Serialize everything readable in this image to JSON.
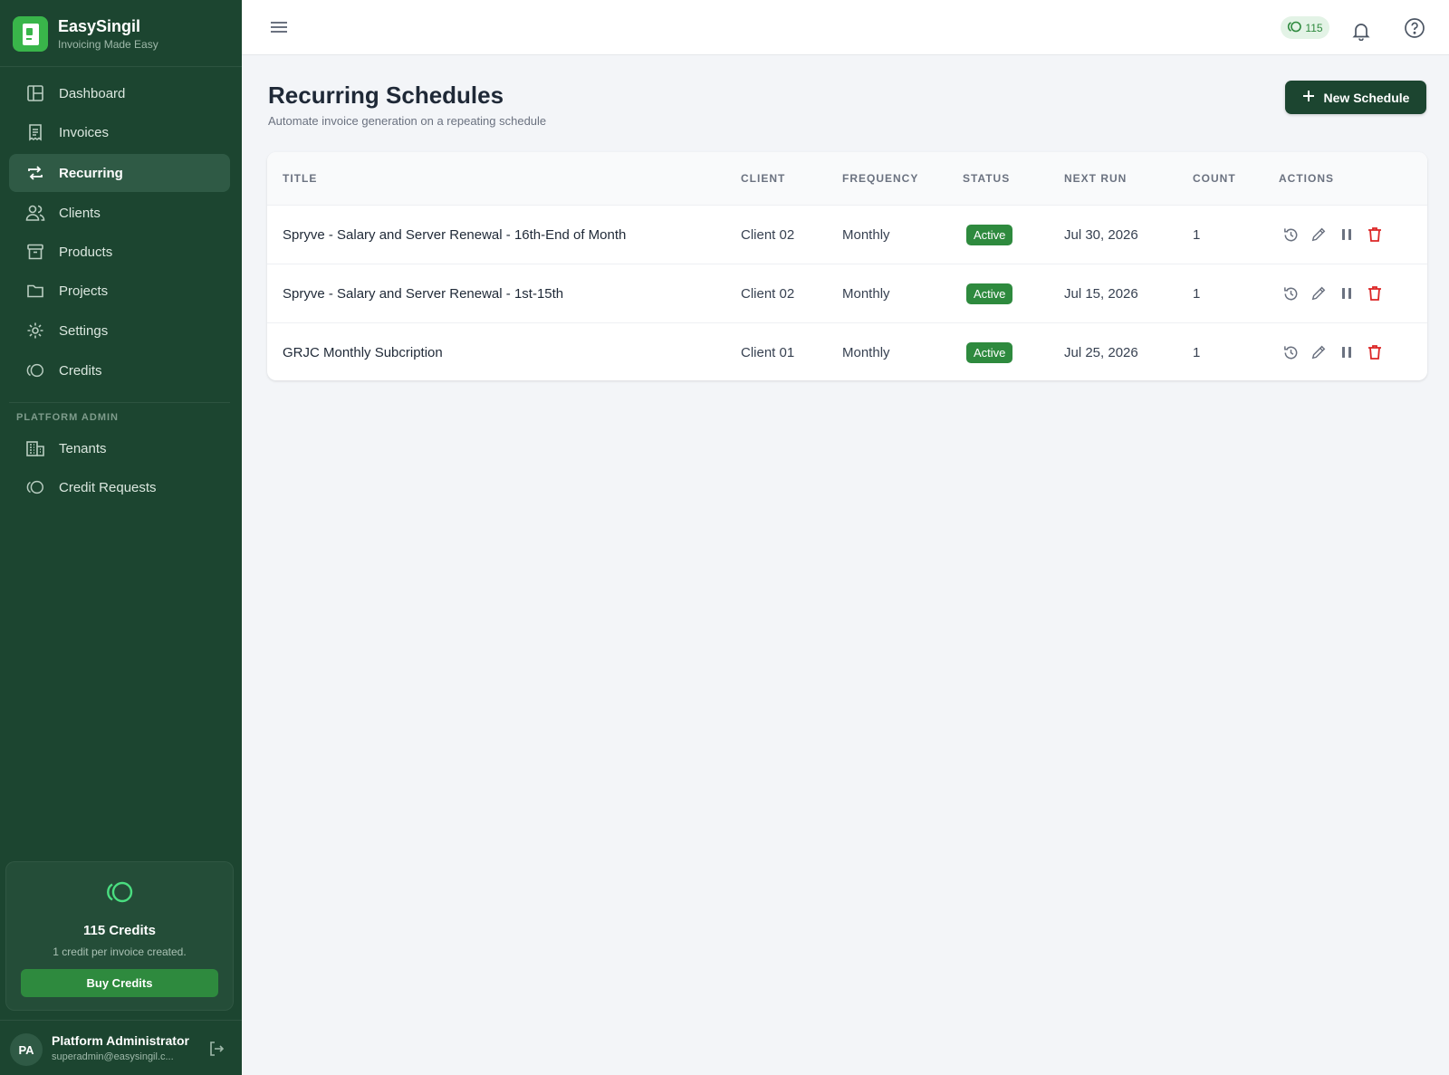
{
  "app": {
    "name": "EasySingil",
    "tagline": "Invoicing Made Easy"
  },
  "sidebar": {
    "items": [
      {
        "label": "Dashboard",
        "icon": "dashboard-icon"
      },
      {
        "label": "Invoices",
        "icon": "invoice-icon"
      },
      {
        "label": "Recurring",
        "icon": "recurring-icon",
        "active": true
      },
      {
        "label": "Clients",
        "icon": "users-icon"
      },
      {
        "label": "Products",
        "icon": "archive-box-icon"
      },
      {
        "label": "Projects",
        "icon": "folder-icon"
      },
      {
        "label": "Settings",
        "icon": "gear-icon"
      },
      {
        "label": "Credits",
        "icon": "coins-icon"
      }
    ],
    "admin_section": "PLATFORM ADMIN",
    "admin_items": [
      {
        "label": "Tenants",
        "icon": "building-icon"
      },
      {
        "label": "Credit Requests",
        "icon": "coins-icon"
      }
    ],
    "credits_card": {
      "title": "115 Credits",
      "subtitle": "1 credit per invoice created.",
      "button": "Buy Credits"
    },
    "user": {
      "initials": "PA",
      "name": "Platform Administrator",
      "email": "superadmin@easysingil.c..."
    }
  },
  "topbar": {
    "credits": "115"
  },
  "page": {
    "title": "Recurring Schedules",
    "subtitle": "Automate invoice generation on a repeating schedule",
    "new_button": "New Schedule"
  },
  "table": {
    "columns": [
      "TITLE",
      "CLIENT",
      "FREQUENCY",
      "STATUS",
      "NEXT RUN",
      "COUNT",
      "ACTIONS"
    ],
    "rows": [
      {
        "title": "Spryve - Salary and Server Renewal - 16th-End of Month",
        "client": "Client 02",
        "frequency": "Monthly",
        "status": "Active",
        "next_run": "Jul 30, 2026",
        "count": "1"
      },
      {
        "title": "Spryve - Salary and Server Renewal - 1st-15th",
        "client": "Client 02",
        "frequency": "Monthly",
        "status": "Active",
        "next_run": "Jul 15, 2026",
        "count": "1"
      },
      {
        "title": "GRJC Monthly Subcription",
        "client": "Client 01",
        "frequency": "Monthly",
        "status": "Active",
        "next_run": "Jul 25, 2026",
        "count": "1"
      }
    ]
  },
  "colors": {
    "sidebar": "#1c4530",
    "accent": "#2e8a3e",
    "danger": "#dc2626"
  }
}
